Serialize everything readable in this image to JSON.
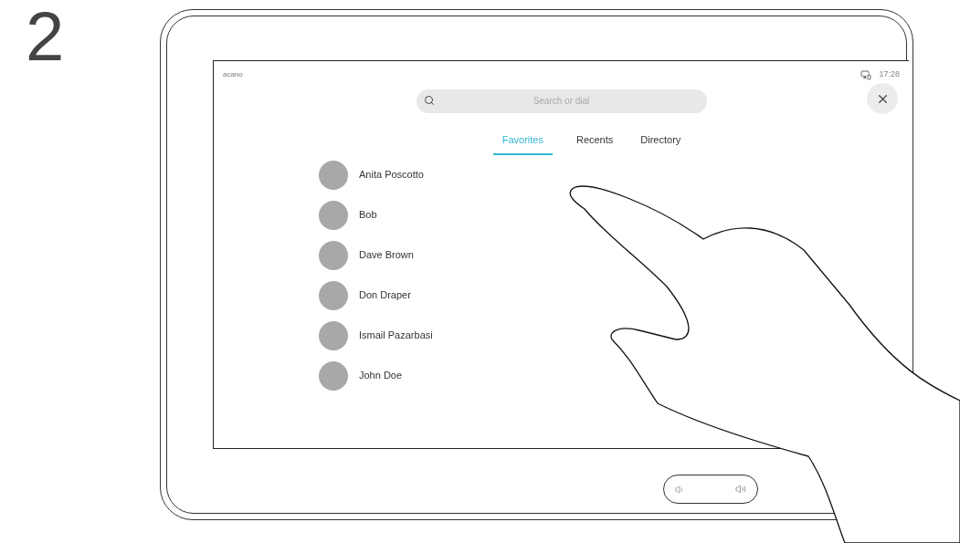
{
  "step": "2",
  "screen": {
    "header": {
      "label": "acano",
      "time": "17:28"
    },
    "search": {
      "placeholder": "Search or dial"
    },
    "tabs": [
      {
        "label": "Favorites",
        "selected": true
      },
      {
        "label": "Recents",
        "selected": false
      },
      {
        "label": "Directory",
        "selected": false
      }
    ],
    "contacts": [
      {
        "name": "Anita Poscotto"
      },
      {
        "name": "Bob"
      },
      {
        "name": "Dave Brown"
      },
      {
        "name": "Don Draper"
      },
      {
        "name": "Ismail Pazarbasi"
      },
      {
        "name": "John Doe"
      }
    ]
  }
}
